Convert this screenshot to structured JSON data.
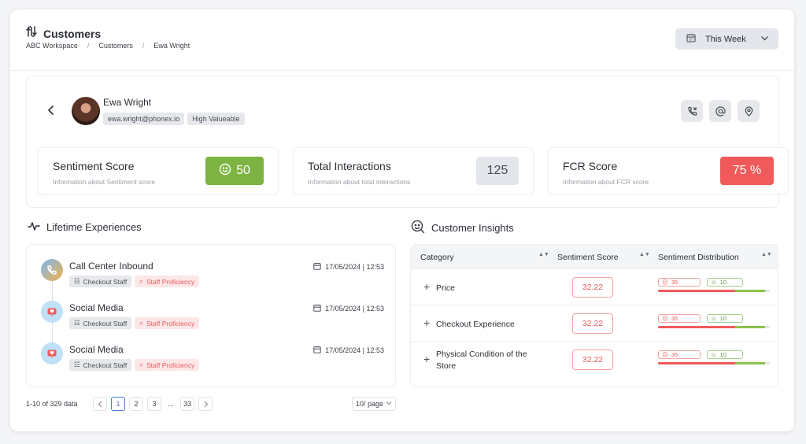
{
  "header": {
    "title": "Customers",
    "breadcrumb": [
      "ABC Workspace",
      "Customers",
      "Ewa Wright"
    ],
    "date_filter": "This Week"
  },
  "profile": {
    "name": "Ewa Wright",
    "email": "ewa.wright@phonex.io",
    "segment": "High Valueable",
    "contact_icons": [
      "phone-icon",
      "at-icon",
      "location-pin-icon"
    ]
  },
  "stats": [
    {
      "title": "Sentiment Score",
      "subtitle": "Information about Sentiment score",
      "value": "50",
      "color": "#7cb342"
    },
    {
      "title": "Total Interactions",
      "subtitle": "Information about total interactions",
      "value": "125",
      "color": "#e3e6ea"
    },
    {
      "title": "FCR Score",
      "subtitle": "Information about FCR score",
      "value": "75 %",
      "color": "#f05a5a"
    }
  ],
  "lifetime": {
    "heading": "Lifetime Experiences",
    "items": [
      {
        "title": "Call Center Inbound",
        "date": "17/05/2024 | 12:53",
        "tag1": "Checkout Staff",
        "tag2": "Staff Proficiency",
        "icon": "phone-call-icon"
      },
      {
        "title": "Social Media",
        "date": "17/05/2024 | 12:53",
        "tag1": "Checkout Staff",
        "tag2": "Staff Proficiency",
        "icon": "social-media-icon"
      },
      {
        "title": "Social Media",
        "date": "17/05/2024 | 12:53",
        "tag1": "Checkout Staff",
        "tag2": "Staff Proficiency",
        "icon": "social-media-icon"
      }
    ],
    "pagination": {
      "total": "1-10 of 329 data",
      "pages": [
        "1",
        "2",
        "3",
        "...",
        "33"
      ],
      "current": "1",
      "per_page": "10/ page"
    }
  },
  "insights": {
    "heading": "Customer Insights",
    "columns": [
      "Category",
      "Sentiment Score",
      "Sentiment Distribution"
    ],
    "rows": [
      {
        "category": "Price",
        "score": "32.22",
        "negative": "35",
        "positive": "10"
      },
      {
        "category": "Checkout Experience",
        "score": "32.22",
        "negative": "35",
        "positive": "10"
      },
      {
        "category": "Physical Condition of the Store",
        "score": "32.22",
        "negative": "35",
        "positive": "10"
      }
    ]
  },
  "colors": {
    "accent_green": "#7cb342",
    "accent_red": "#f05a5a",
    "link_blue": "#4a7bd0"
  }
}
